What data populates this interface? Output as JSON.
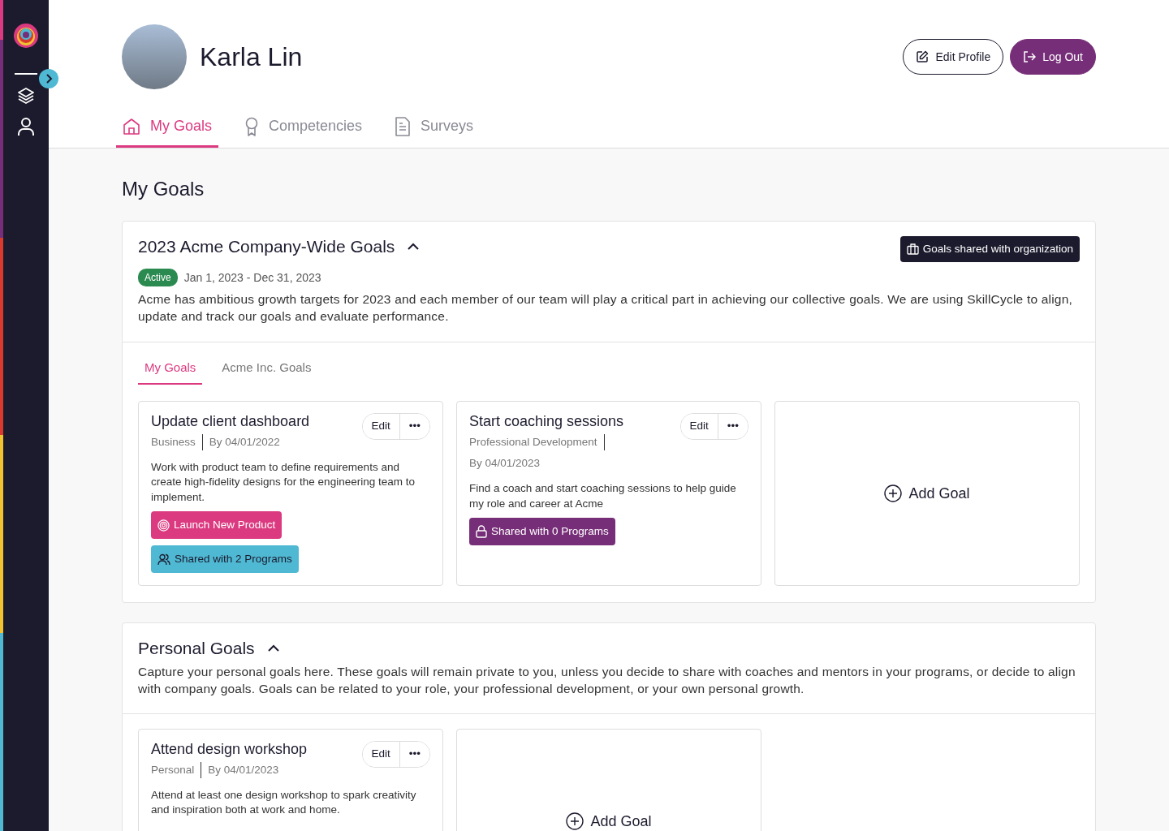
{
  "profile": {
    "name": "Karla Lin"
  },
  "header_buttons": [
    {
      "label": "Edit Profile",
      "kind": "outline"
    },
    {
      "label": "Log Out",
      "kind": "primary"
    }
  ],
  "tabs": [
    {
      "label": "My Goals",
      "selected": true
    },
    {
      "label": "Competencies",
      "selected": false
    },
    {
      "label": "Surveys",
      "selected": false
    }
  ],
  "page_title": "My Goals",
  "sections": [
    {
      "title": "2023 Acme Company-Wide Goals",
      "expanded": true,
      "status": "Active",
      "dates": "Jan 1, 2023 - Dec 31, 2023",
      "org_button": "Goals shared with organization",
      "description": "Acme has ambitious growth targets for 2023 and each member of our team will play a critical part in achieving our collective goals. We are using SkillCycle to align, update and track our goals and evaluate performance.",
      "subtabs": [
        {
          "label": "My Goals",
          "selected": true
        },
        {
          "label": "Acme Inc. Goals",
          "selected": false
        }
      ],
      "goals": [
        {
          "title": "Update client dashboard",
          "category": "Business",
          "due": "By 04/01/2022",
          "description": "Work with product team to define requirements and create high-fidelity designs for the engineering team to implement.",
          "edit": "Edit",
          "more": "•••",
          "tags": [
            {
              "label": "Launch New Product",
              "kind": "objective"
            },
            {
              "label": "Shared with 2 Programs",
              "kind": "shared"
            }
          ]
        },
        {
          "title": "Start coaching sessions",
          "category": "Professional Development",
          "due": "By 04/01/2023",
          "description": "Find a coach and start coaching sessions to help guide my role and career at Acme",
          "edit": "Edit",
          "more": "•••",
          "tags": [
            {
              "label": "Shared with 0 Programs",
              "kind": "private"
            }
          ]
        }
      ],
      "add_goal": "Add Goal"
    },
    {
      "title": "Personal Goals",
      "expanded": true,
      "description": "Capture your personal goals here. These goals will remain private to you, unless you decide to share with coaches and mentors in your programs, or decide to align with company goals. Goals can be related to your role, your professional development, or your own personal growth.",
      "goals": [
        {
          "title": "Attend design workshop",
          "category": "Personal",
          "due": "By 04/01/2023",
          "description": "Attend at least one design workshop to spark creativity and inspiration both at work and home.",
          "edit": "Edit",
          "more": "•••"
        }
      ],
      "add_goal": "Add Goal"
    }
  ]
}
